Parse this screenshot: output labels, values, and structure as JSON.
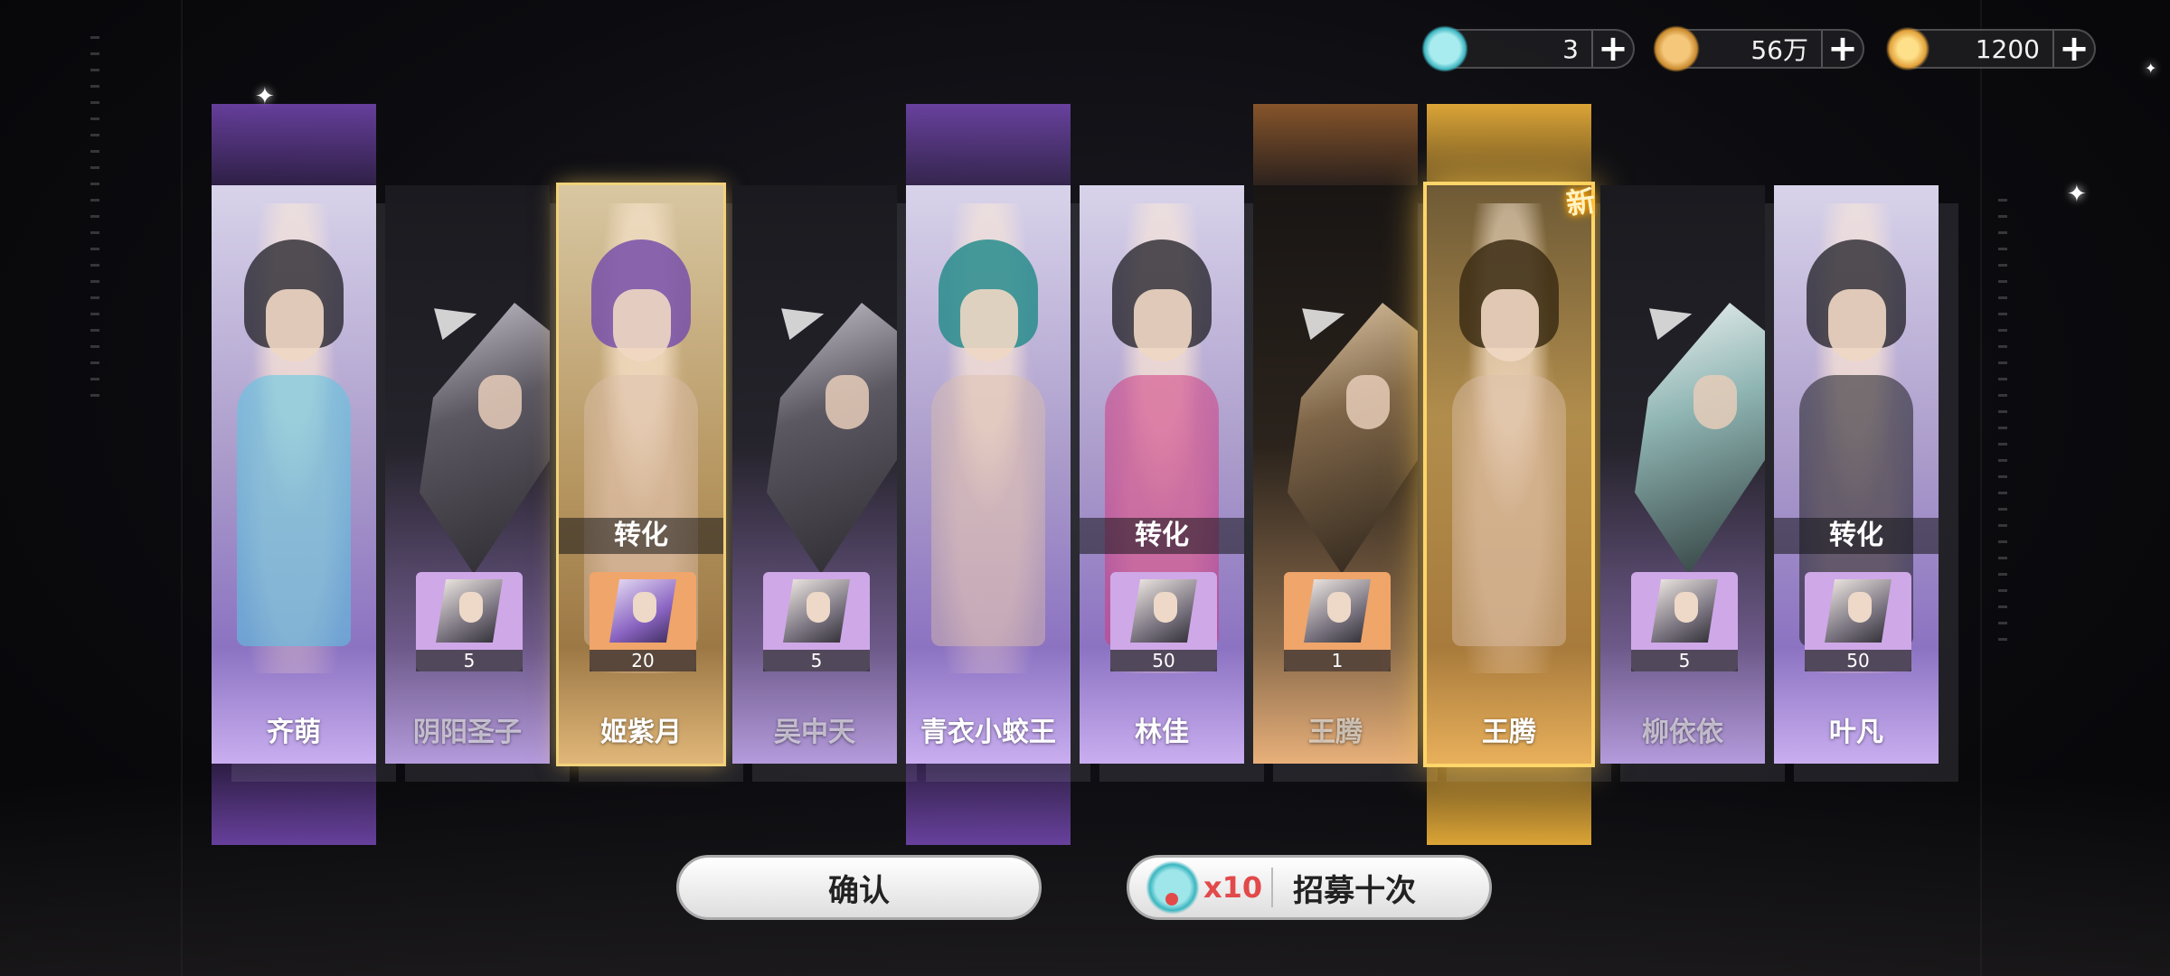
{
  "currencies": [
    {
      "icon": "fish-ticket-icon",
      "value": "3"
    },
    {
      "icon": "gold-coin-icon",
      "value": "56万"
    },
    {
      "icon": "spirit-stone-icon",
      "value": "1200"
    }
  ],
  "cards": [
    {
      "name": "齐萌",
      "rarity": "purple",
      "type": "new-hero",
      "convert": "",
      "shard_count": "",
      "is_new": false
    },
    {
      "name": "阴阳圣子",
      "rarity": "silver",
      "type": "duplicate",
      "convert": "",
      "shard_count": "5",
      "is_new": false
    },
    {
      "name": "姬紫月",
      "rarity": "gold",
      "type": "converted",
      "convert": "转化",
      "shard_count": "20",
      "is_new": false
    },
    {
      "name": "吴中天",
      "rarity": "silver",
      "type": "duplicate",
      "convert": "",
      "shard_count": "5",
      "is_new": false
    },
    {
      "name": "青衣小蛟王",
      "rarity": "purple",
      "type": "new-hero",
      "convert": "",
      "shard_count": "",
      "is_new": false
    },
    {
      "name": "林佳",
      "rarity": "purple",
      "type": "converted",
      "convert": "转化",
      "shard_count": "50",
      "is_new": false
    },
    {
      "name": "王腾",
      "rarity": "orange",
      "type": "duplicate",
      "convert": "",
      "shard_count": "1",
      "is_new": false
    },
    {
      "name": "王腾",
      "rarity": "legend",
      "type": "new-hero",
      "convert": "",
      "shard_count": "",
      "is_new": true
    },
    {
      "name": "柳依依",
      "rarity": "silver",
      "type": "duplicate",
      "convert": "",
      "shard_count": "5",
      "is_new": false
    },
    {
      "name": "叶凡",
      "rarity": "purple",
      "type": "converted",
      "convert": "转化",
      "shard_count": "50",
      "is_new": false
    }
  ],
  "new_label": "新",
  "buttons": {
    "confirm": "确认",
    "recruit_cost": "x10",
    "recruit_label": "招募十次"
  },
  "colors": {
    "purple_glow": "#9a5ae6",
    "gold_glow": "#ffbe3c",
    "cost_red": "#e24a4a"
  }
}
